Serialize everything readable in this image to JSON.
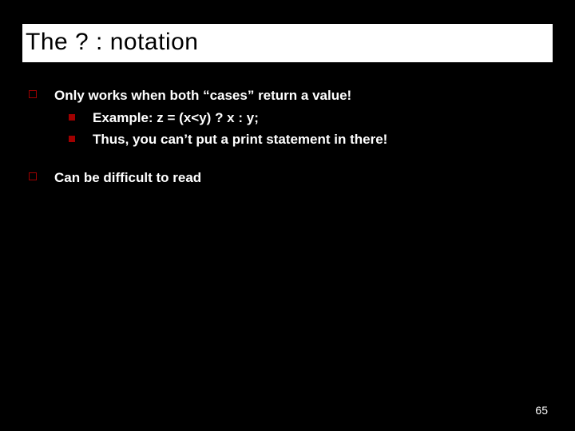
{
  "title": "The ? : notation",
  "bullets": [
    {
      "text": "Only works when both “cases” return a value!",
      "children": [
        {
          "text": "Example: z = (x<y) ? x : y;"
        },
        {
          "text": "Thus, you can’t put a print statement in there!"
        }
      ]
    },
    {
      "text": "Can be difficult to read",
      "children": []
    }
  ],
  "page_number": "65"
}
